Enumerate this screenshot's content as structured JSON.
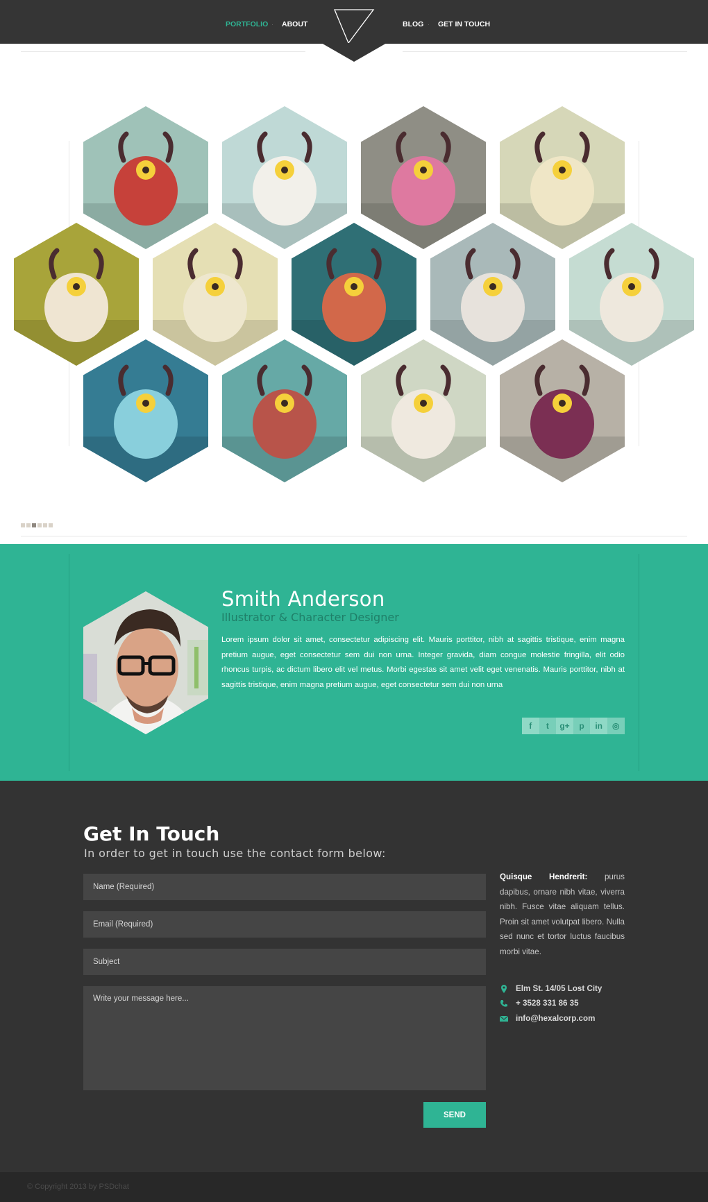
{
  "nav": {
    "left": [
      "PORTFOLIO",
      "ABOUT"
    ],
    "right": [
      "BLOG",
      "GET IN TOUCH"
    ],
    "active": "PORTFOLIO",
    "logo_icon": "triangle-logo-icon"
  },
  "portfolio": {
    "items": [
      {
        "name": "red-horned-cyclops",
        "bg": "#9fc2b8",
        "fg": "#c6413a"
      },
      {
        "name": "flying-sheep",
        "bg": "#bfd9d6",
        "fg": "#f2f0ea"
      },
      {
        "name": "pink-cow-monster",
        "bg": "#8f8e85",
        "fg": "#de79a0"
      },
      {
        "name": "fluffy-yeti-circus",
        "bg": "#d6d7b8",
        "fg": "#efe6c6"
      },
      {
        "name": "sleeping-pig",
        "bg": "#a8a43a",
        "fg": "#efe5d2"
      },
      {
        "name": "white-deer",
        "bg": "#e5dfb4",
        "fg": "#eee7ce"
      },
      {
        "name": "octopus-monster",
        "bg": "#2f6f75",
        "fg": "#d2684a"
      },
      {
        "name": "yeti-handshake",
        "bg": "#a9b9b9",
        "fg": "#e7e2dc"
      },
      {
        "name": "white-ape",
        "bg": "#c5dcd2",
        "fg": "#eee8dd"
      },
      {
        "name": "jellyfish",
        "bg": "#357c93",
        "fg": "#89cfdc"
      },
      {
        "name": "tribal-mask-creature",
        "bg": "#66a9a6",
        "fg": "#b8544a"
      },
      {
        "name": "winged-bird-creature",
        "bg": "#cfd7c4",
        "fg": "#efe9df"
      },
      {
        "name": "horned-purple-blob",
        "bg": "#b7b1a6",
        "fg": "#7b2f53"
      }
    ],
    "pager": {
      "count": 6,
      "active": 3
    }
  },
  "about": {
    "name": "Smith Anderson",
    "role": "Illustrator & Character Designer",
    "bio": "Lorem ipsum dolor sit amet, consectetur adipiscing elit. Mauris porttitor, nibh at sagittis tristique, enim magna pretium augue, eget consectetur sem dui non urna. Integer gravida, diam congue molestie fringilla, elit odio rhoncus turpis, ac dictum libero elit vel metus. Morbi egestas sit amet velit eget venenatis. Mauris porttitor, nibh at sagittis tristique, enim magna pretium augue, eget consectetur sem dui non urna",
    "socials": [
      {
        "name": "facebook-icon",
        "glyph": "f"
      },
      {
        "name": "twitter-icon",
        "glyph": "t"
      },
      {
        "name": "google-plus-icon",
        "glyph": "g+"
      },
      {
        "name": "pinterest-icon",
        "glyph": "p"
      },
      {
        "name": "linkedin-icon",
        "glyph": "in"
      },
      {
        "name": "dribbble-icon",
        "glyph": "◎"
      }
    ]
  },
  "contact": {
    "title": "Get In Touch",
    "subtitle": "In order to get in touch use the contact form below:",
    "name_placeholder": "Name (Required)",
    "email_placeholder": "Email (Required)",
    "subject_placeholder": "Subject",
    "message_placeholder": "Write your message here...",
    "send_label": "SEND",
    "blurb_bold": "Quisque Hendrerit:",
    "blurb": "purus dapibus, ornare nibh vitae, viverra nibh. Fusce vitae aliquam tellus. Proin sit amet volutpat libero. Nulla sed nunc et tortor luctus faucibus morbi vitae.",
    "address": "Elm St. 14/05 Lost City",
    "phone": "+ 3528 331 86 35",
    "email": "info@hexalcorp.com",
    "accent": "#2fb494"
  },
  "footer": {
    "copyright": "© Copyright 2013 by PSDchat"
  }
}
